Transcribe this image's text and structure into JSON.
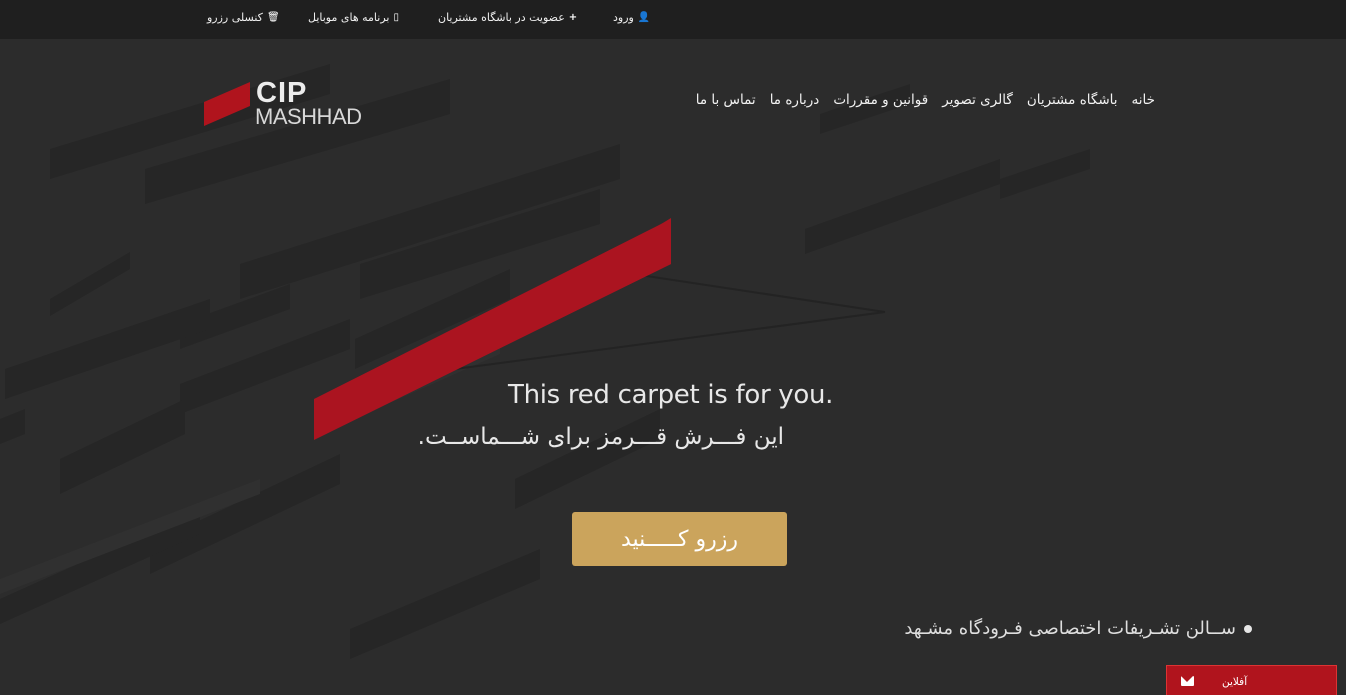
{
  "topbar": {
    "login": "ورود",
    "login_icon": "user-icon",
    "membership": "عضویت در باشگاه مشتریان",
    "membership_icon": "plus-icon",
    "mobile_apps": "برنامه های موبایل",
    "mobile_icon": "mobile-icon",
    "cancel_reservation": "کنسلی رزرو",
    "cancel_icon": "trash-icon"
  },
  "logo": {
    "brand": "CIP",
    "city": "MASHHAD"
  },
  "nav": {
    "items": [
      "خانه",
      "باشگاه مشتریان",
      "گالری تصویر",
      "قوانین و مقررات",
      "درباره ما",
      "تماس با ما"
    ]
  },
  "hero": {
    "title_en": "This red carpet is for you.",
    "title_fa": "این فـــرش قـــرمز برای شـــماســت.",
    "cta_label": "رزرو کـــــنید"
  },
  "footer_note": "ســالن تشـریفات اختصاصی فـرودگاه مشـهد",
  "chat": {
    "label": "آفلاین",
    "icon": "envelope-icon"
  },
  "colors": {
    "accent_red": "#b0141d",
    "cta_gold": "#cba45c",
    "background": "#2c2c2c",
    "topbar": "#1f1f1f"
  }
}
